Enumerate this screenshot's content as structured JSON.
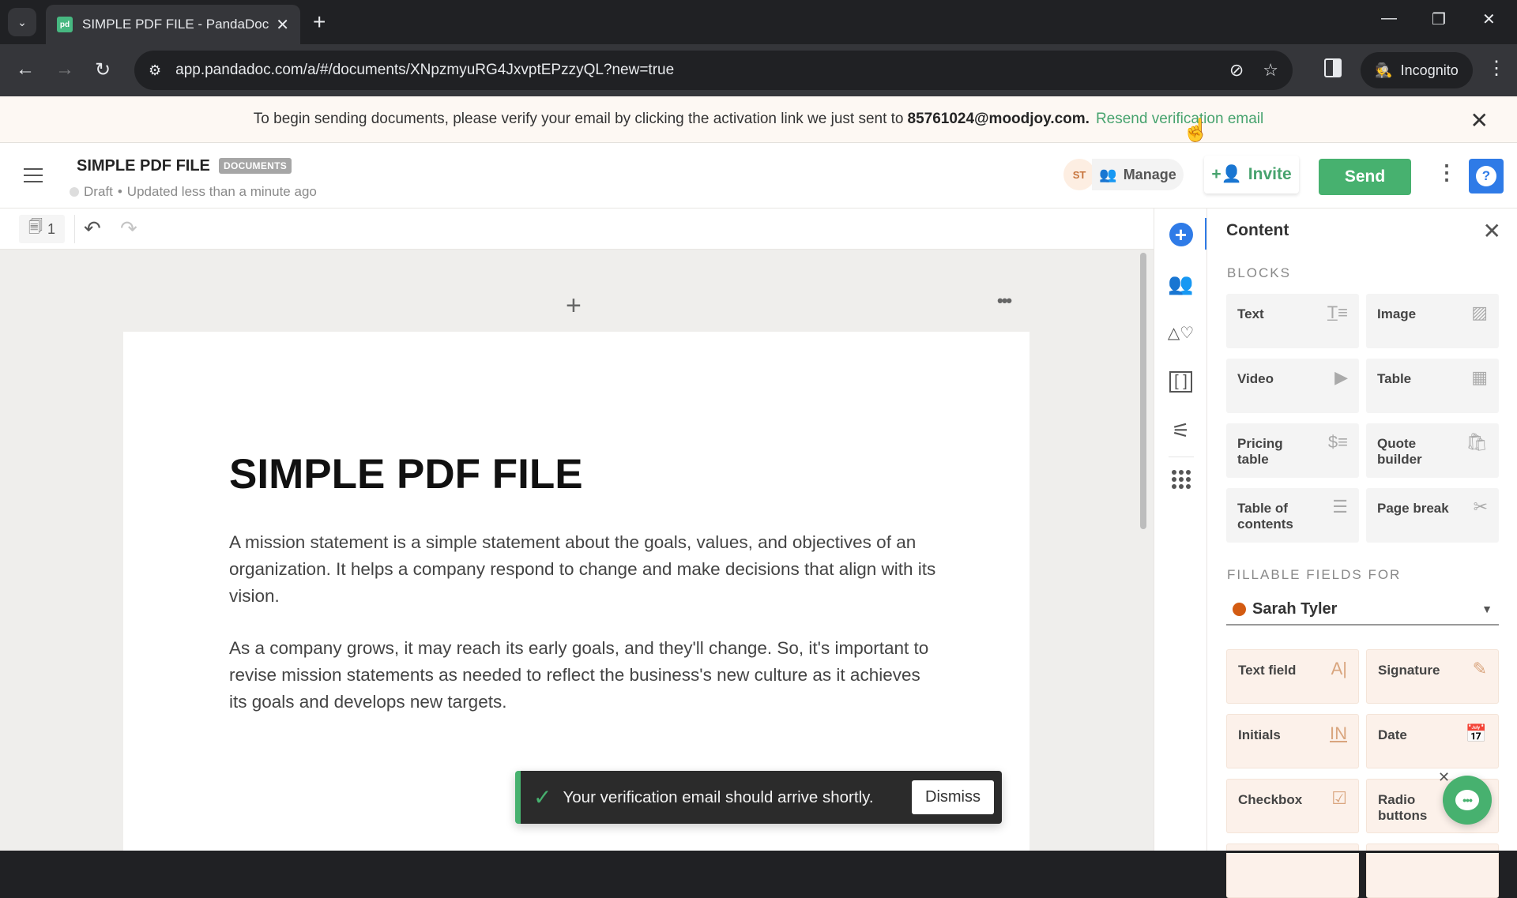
{
  "browser": {
    "tab_title": "SIMPLE PDF FILE - PandaDoc",
    "favicon_text": "pd",
    "url": "app.pandadoc.com/a/#/documents/XNpzmyuRG4JxvptEPzzyQL?new=true",
    "incognito_label": "Incognito"
  },
  "banner": {
    "text": "To begin sending documents, please verify your email by clicking the activation link we just sent to",
    "email": "85761024@moodjoy.com.",
    "resend_link": "Resend verification email"
  },
  "header": {
    "doc_title": "SIMPLE PDF FILE",
    "badge": "DOCUMENTS",
    "status": "Draft",
    "updated": "Updated less than a minute ago",
    "avatar_initials": "ST",
    "manage_label": "Manage",
    "invite_label": "Invite",
    "send_label": "Send",
    "help_label": "?"
  },
  "toolbar": {
    "page_count": "1"
  },
  "document": {
    "heading": "SIMPLE PDF FILE",
    "paragraphs": [
      "A mission statement is a simple statement about the goals, values, and objectives of an organization. It helps a company respond to change and make decisions that align with its vision.",
      "As a company grows, it may reach its early goals, and they'll change. So, it's important to revise mission statements as needed to reflect the business's new culture as it achieves its goals and develops new targets."
    ]
  },
  "toast": {
    "message": "Your verification email should arrive shortly.",
    "dismiss_label": "Dismiss"
  },
  "panel": {
    "title": "Content",
    "blocks_label": "BLOCKS",
    "blocks": [
      {
        "label": "Text",
        "icon": "text-icon"
      },
      {
        "label": "Image",
        "icon": "image-icon"
      },
      {
        "label": "Video",
        "icon": "video-icon"
      },
      {
        "label": "Table",
        "icon": "table-icon"
      },
      {
        "label": "Pricing table",
        "icon": "pricing-table-icon"
      },
      {
        "label": "Quote builder",
        "icon": "shopping-bag-icon"
      },
      {
        "label": "Table of contents",
        "icon": "list-icon"
      },
      {
        "label": "Page break",
        "icon": "scissors-icon"
      }
    ],
    "fields_label": "FILLABLE FIELDS FOR",
    "recipient": "Sarah Tyler",
    "recipient_color": "#d35b12",
    "fields": [
      {
        "label": "Text field",
        "icon": "text-field-icon"
      },
      {
        "label": "Signature",
        "icon": "signature-icon"
      },
      {
        "label": "Initials",
        "icon": "initials-icon"
      },
      {
        "label": "Date",
        "icon": "calendar-icon"
      },
      {
        "label": "Checkbox",
        "icon": "checkbox-icon"
      },
      {
        "label": "Radio buttons",
        "icon": "radio-icon"
      }
    ]
  },
  "colors": {
    "brand_green": "#47b16f",
    "accent_blue": "#2f7be7",
    "banner_bg": "#fdf8f3"
  }
}
